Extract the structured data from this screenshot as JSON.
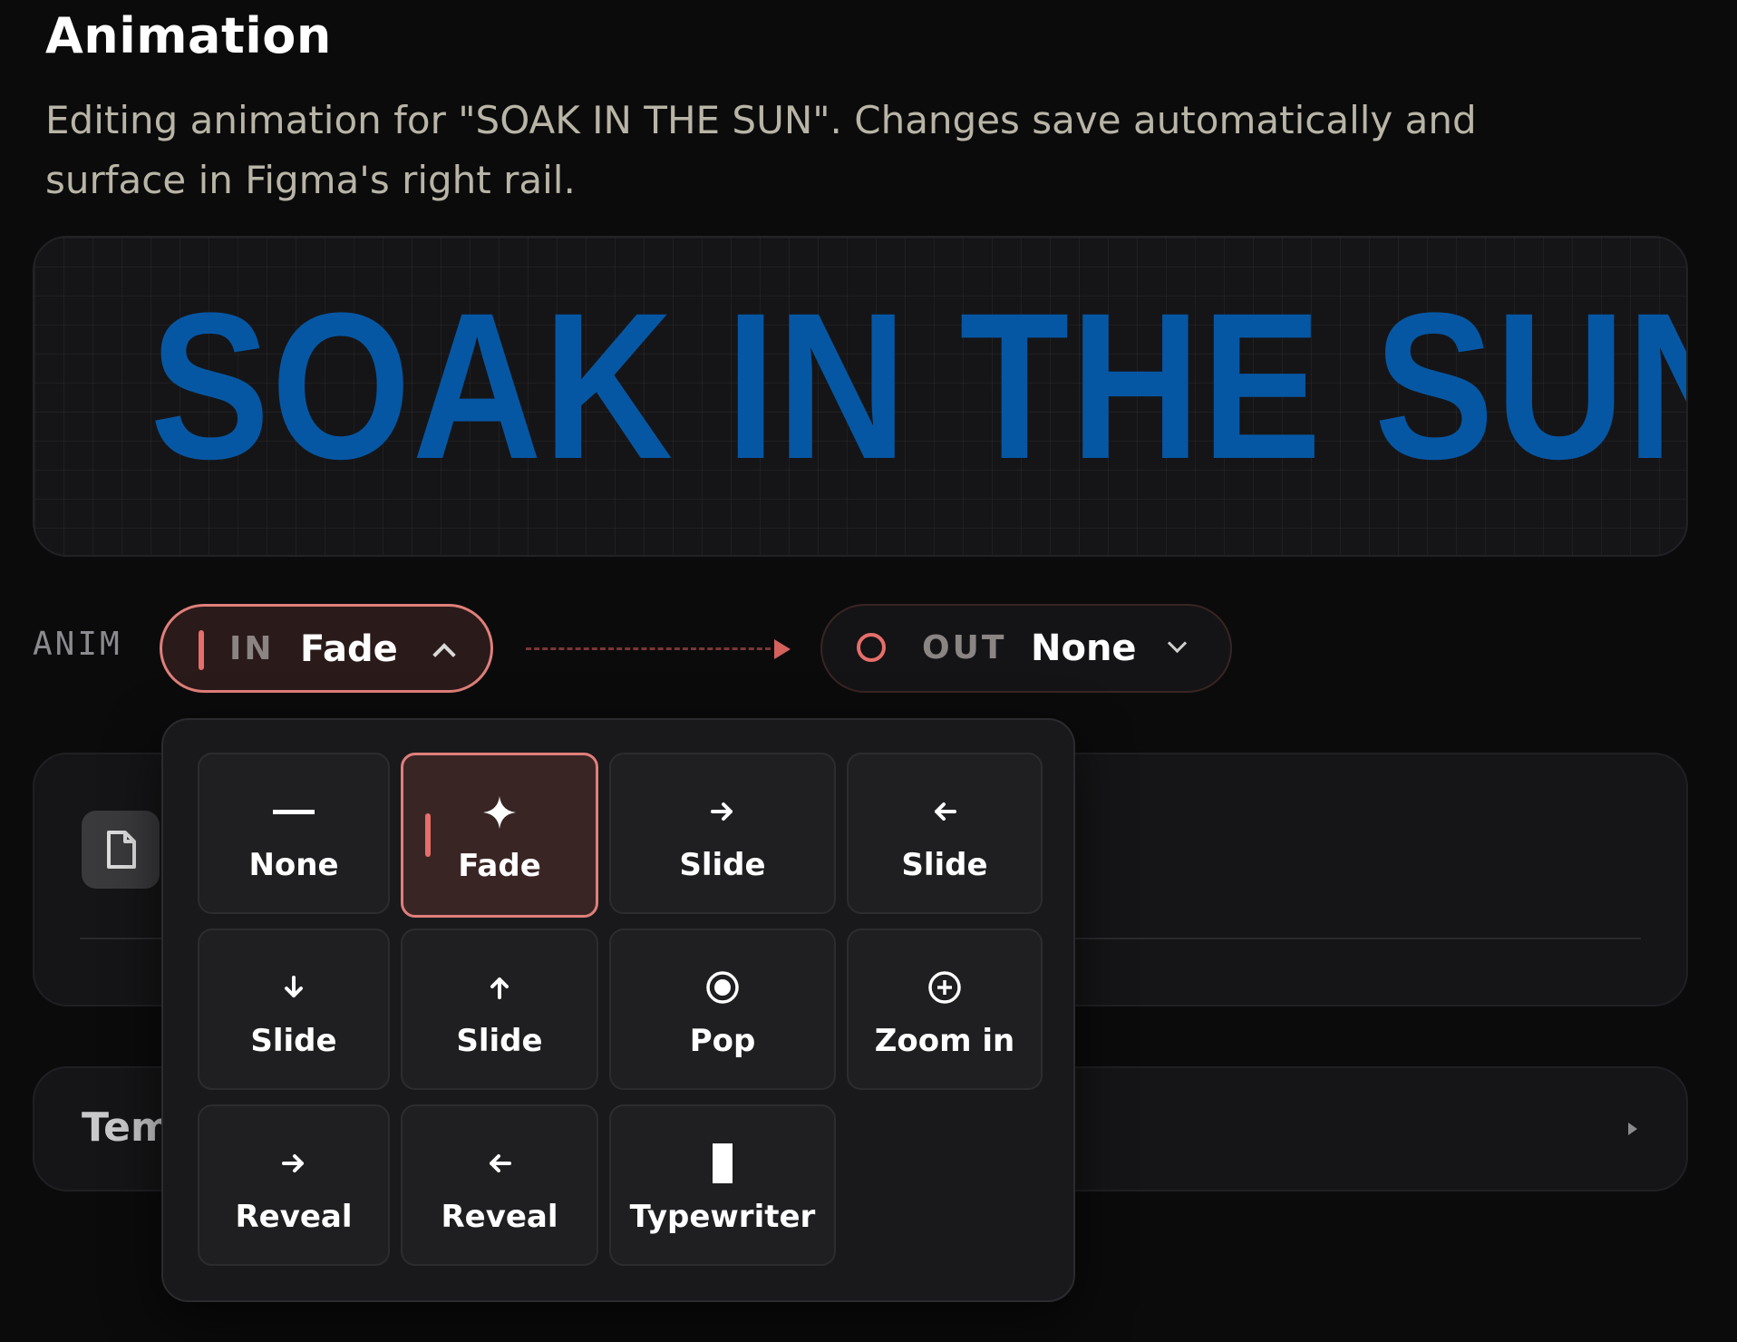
{
  "header": {
    "title": "Animation",
    "subtitle": "Editing animation for \"SOAK IN THE SUN\". Changes save automatically and surface in Figma's right rail."
  },
  "preview": {
    "text": "SOAK IN THE SUN",
    "text_color": "#0657a3"
  },
  "anim_row": {
    "label": "ANIM",
    "in": {
      "keyword": "IN",
      "value": "Fade",
      "expanded": true
    },
    "out": {
      "keyword": "OUT",
      "value": "None",
      "expanded": false
    }
  },
  "background_cards": {
    "second_label_visible": "Tem"
  },
  "dropdown": {
    "options": [
      {
        "label": "None",
        "icon": "dash-icon"
      },
      {
        "label": "Fade",
        "icon": "sparkle-icon",
        "selected": true
      },
      {
        "label": "Slide",
        "icon": "arrow-right-icon"
      },
      {
        "label": "Slide",
        "icon": "arrow-left-icon"
      },
      {
        "label": "Slide",
        "icon": "arrow-down-icon"
      },
      {
        "label": "Slide",
        "icon": "arrow-up-icon"
      },
      {
        "label": "Pop",
        "icon": "target-icon"
      },
      {
        "label": "Zoom in",
        "icon": "plus-circle-icon"
      },
      {
        "label": "Reveal",
        "icon": "arrow-right-icon"
      },
      {
        "label": "Reveal",
        "icon": "arrow-left-icon"
      },
      {
        "label": "Typewriter",
        "icon": "cursor-block-icon"
      }
    ]
  },
  "colors": {
    "accent": "#e07f7a",
    "accent_strong": "#e76e6a",
    "background": "#0b0b0c",
    "muted_text": "#b9b5a6"
  }
}
